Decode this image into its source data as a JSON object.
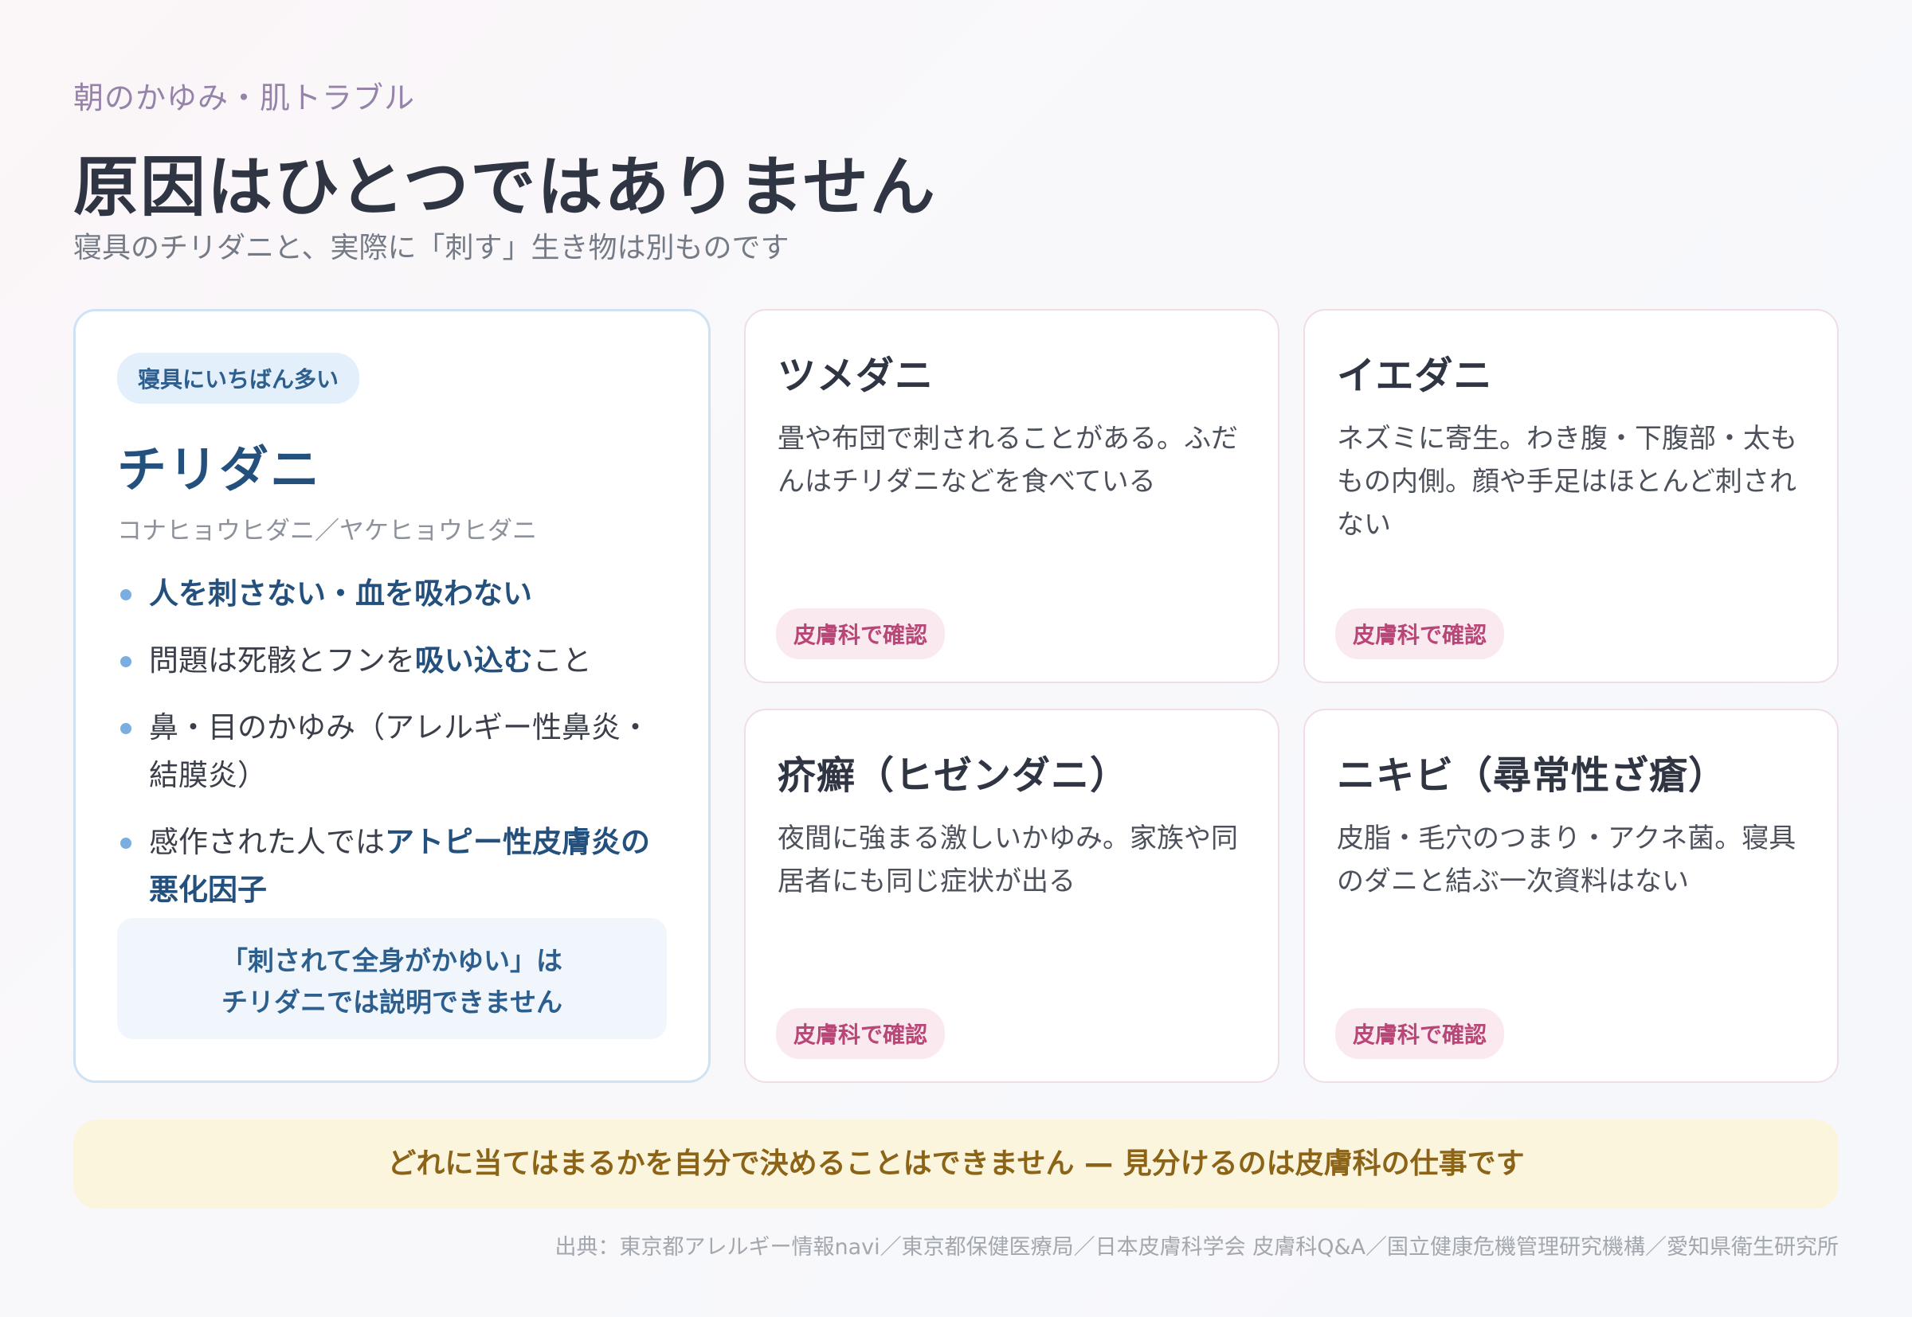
{
  "header": {
    "eyebrow": "朝のかゆみ・肌トラブル",
    "title": "原因はひとつではありません",
    "subtitle": "寝具のチリダニと、実際に「刺す」生き物は別ものです"
  },
  "main_card": {
    "tag": "寝具にいちばん多い",
    "name": "チリダニ",
    "alt_names": "コナヒョウヒダニ／ヤケヒョウヒダニ",
    "points": [
      {
        "text": "人を刺さない・血を吸わない"
      },
      {
        "pre": "問題は死骸とフンを",
        "bold": "吸い込む",
        "post": "こと"
      },
      {
        "text": "鼻・目のかゆみ（アレルギー性鼻炎・結膜炎）"
      },
      {
        "pre": "感作された人では",
        "bold": "アトピー性皮膚炎の悪化因子",
        "post": ""
      }
    ],
    "note_line1": "「刺されて全身がかゆい」は",
    "note_line2": "チリダニでは説明できません"
  },
  "cards": [
    {
      "title": "ツメダニ",
      "desc": "畳や布団で刺されることがある。ふだんはチリダニなどを食べている",
      "badge": "皮膚科で確認"
    },
    {
      "title": "イエダニ",
      "desc": "ネズミに寄生。わき腹・下腹部・太ももの内側。顔や手足はほとんど刺されない",
      "badge": "皮膚科で確認"
    },
    {
      "title": "疥癬（ヒゼンダニ）",
      "desc": "夜間に強まる激しいかゆみ。家族や同居者にも同じ症状が出る",
      "badge": "皮膚科で確認"
    },
    {
      "title": "ニキビ（尋常性ざ瘡）",
      "desc": "皮脂・毛穴のつまり・アクネ菌。寝具のダニと結ぶ一次資料はない",
      "badge": "皮膚科で確認"
    }
  ],
  "banner": "どれに当てはまるかを自分で決めることはできません — 見分けるのは皮膚科の仕事です",
  "source": "出典：東京都アレルギー情報navi／東京都保健医療局／日本皮膚科学会 皮膚科Q&A／国立健康危機管理研究機構／愛知県衛生研究所",
  "colors": {
    "accent_blue": "#24507d",
    "badge_pink": "#b84777",
    "banner_bg": "#fcf5de",
    "banner_text": "#8c6418"
  }
}
